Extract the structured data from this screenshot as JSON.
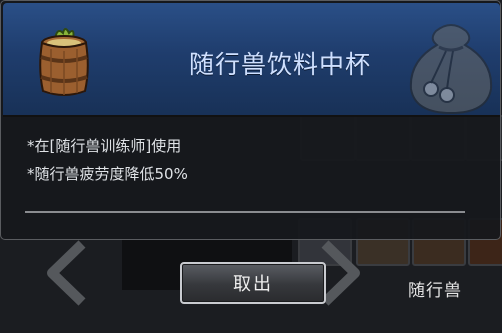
{
  "tooltip": {
    "title": "随行兽饮料中杯",
    "item_icon": "barrel-icon",
    "corner_icon": "pouch-icon",
    "description": [
      "*在[随行兽训练师]使用",
      "*随行兽疲劳度降低50%"
    ]
  },
  "actions": {
    "withdraw_label": "取出"
  },
  "background": {
    "tab_label": "随行兽"
  },
  "colors": {
    "header": "#1f3d6d",
    "title_text": "#cfe0ff"
  }
}
